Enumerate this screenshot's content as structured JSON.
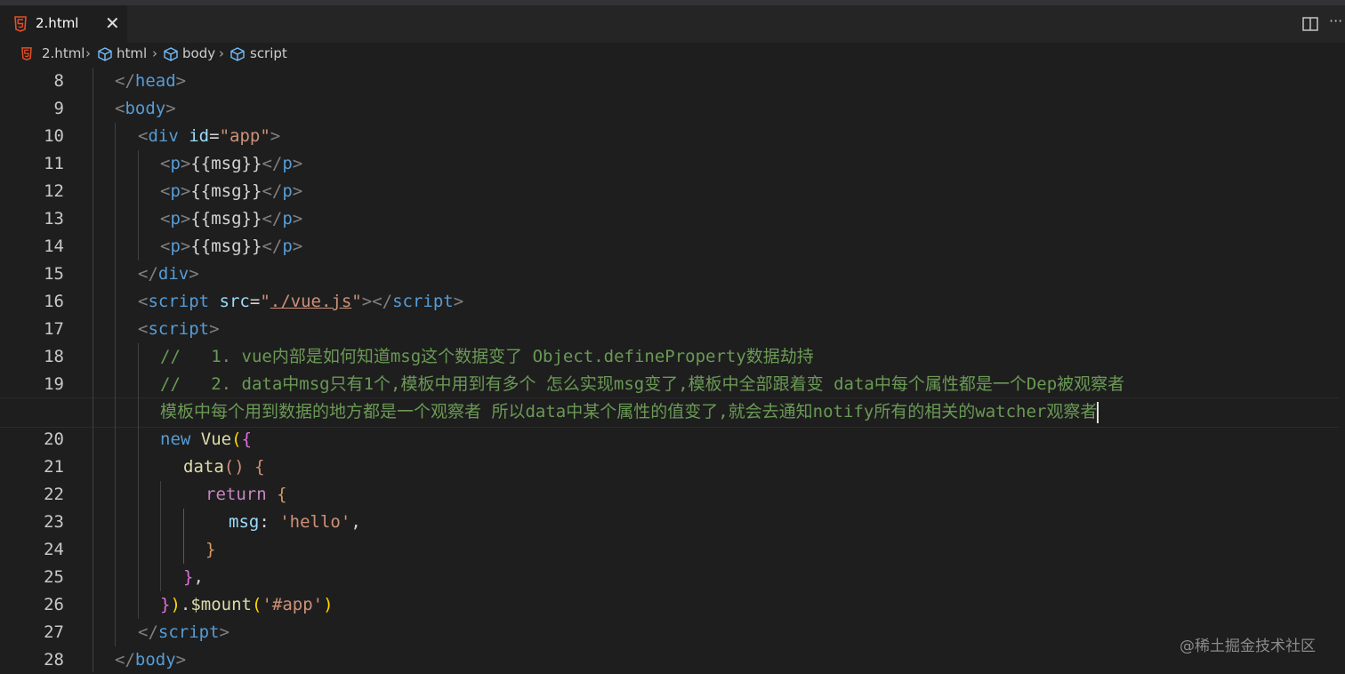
{
  "tab": {
    "title": "2.html",
    "close": "✕"
  },
  "editor_actions": {
    "more": "···"
  },
  "breadcrumb": {
    "file": "2.html",
    "items": [
      "html",
      "body",
      "script"
    ]
  },
  "line_numbers": [
    "8",
    "9",
    "10",
    "11",
    "12",
    "13",
    "14",
    "15",
    "16",
    "17",
    "18",
    "19",
    "20",
    "21",
    "22",
    "23",
    "24",
    "25",
    "26",
    "27",
    "28"
  ],
  "code": {
    "l8": {
      "open": "</",
      "name": "head",
      "close": ">"
    },
    "l9": {
      "open": "<",
      "name": "body",
      "close": ">"
    },
    "l10": {
      "open": "<",
      "name": "div",
      "attr": "id",
      "eq": "=",
      "val": "\"app\"",
      "close": ">"
    },
    "p_line": {
      "open": "<",
      "name": "p",
      "close": ">",
      "text": "{{msg}}",
      "endopen": "</",
      "endname": "p",
      "endclose": ">"
    },
    "l15": {
      "open": "</",
      "name": "div",
      "close": ">"
    },
    "l16": {
      "open": "<",
      "name": "script",
      "attr": "src",
      "eq": "=",
      "q1": "\"",
      "val": "./vue.js",
      "q2": "\"",
      "mid": "></",
      "endname": "script",
      "endclose": ">"
    },
    "l17": {
      "open": "<",
      "name": "script",
      "close": ">"
    },
    "l18": "//   1. vue内部是如何知道msg这个数据变了 Object.defineProperty数据劫持",
    "l19a": "//   2. data中msg只有1个,模板中用到有多个 怎么实现msg变了,模板中全部跟着变 data中每个属性都是一个Dep被观察者",
    "l19b": "模板中每个用到数据的地方都是一个观察者 所以data中某个属性的值变了,就会去通知notify所有的相关的watcher观察者",
    "l20": {
      "kw": "new",
      "fn": "Vue",
      "p": "(",
      "b": "{"
    },
    "l21": {
      "fn": "data",
      "p": "()",
      "b": "{"
    },
    "l22": {
      "kw": "return",
      "b": "{"
    },
    "l23": {
      "key": "msg",
      "colon": ":",
      "val": "'hello'",
      "comma": ","
    },
    "l24": {
      "b": "}"
    },
    "l25": {
      "b": "}",
      "comma": ","
    },
    "l26": {
      "b": "}",
      "p": ")",
      "dot": ".",
      "fn": "$mount",
      "p2": "(",
      "val": "'#app'",
      "p3": ")"
    },
    "l27": {
      "open": "</",
      "name": "script",
      "close": ">"
    },
    "l28": {
      "open": "</",
      "name": "body",
      "close": ">"
    }
  },
  "watermark": "@稀土掘金技术社区",
  "colors": {
    "background": "#1e1e1e",
    "tag": "#569cd6",
    "attribute": "#9cdcfe",
    "string": "#ce9178",
    "comment": "#6a9955",
    "keyword": "#c586c0",
    "function": "#dcdcaa"
  }
}
